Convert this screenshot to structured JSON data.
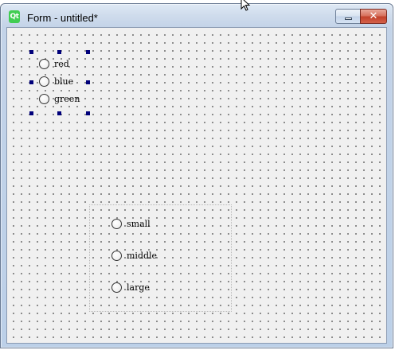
{
  "window": {
    "app_icon_text": "Qt",
    "title": "Form - untitled*",
    "close_glyph": "✕",
    "minimize_icon": "minimize-icon"
  },
  "form": {
    "color_group": {
      "options": [
        {
          "label": "red"
        },
        {
          "label": "blue"
        },
        {
          "label": "green"
        }
      ],
      "selected": true
    },
    "size_group": {
      "options": [
        {
          "label": "small"
        },
        {
          "label": "middle"
        },
        {
          "label": "large"
        }
      ]
    }
  },
  "colors": {
    "selection_handle": "#00007a",
    "qt_green": "#41cd52",
    "close_red": "#c2412a"
  }
}
